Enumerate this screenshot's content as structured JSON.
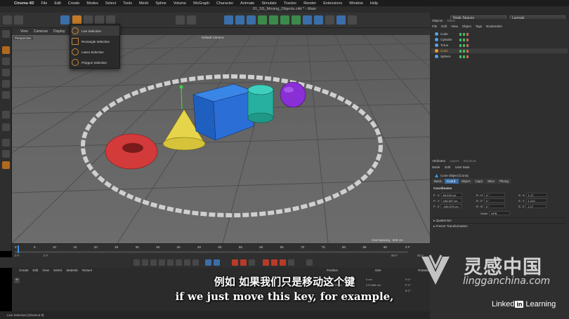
{
  "mac_menu": {
    "apple": "",
    "app": "Cinema 4D",
    "items": [
      "File",
      "Edit",
      "Create",
      "Modes",
      "Select",
      "Tools",
      "Mesh",
      "Spline",
      "Volume",
      "MoGraph",
      "Character",
      "Animate",
      "Simulate",
      "Tracker",
      "Render",
      "Extensions",
      "Window",
      "Help"
    ]
  },
  "window": {
    "title": "01_SS_Moving_Objects.c4d * - Main"
  },
  "layout": {
    "node_spaces": "Node Spaces",
    "layouts": "Layouts"
  },
  "viewport": {
    "menu": [
      "View",
      "Cameras",
      "Display"
    ],
    "label": "Perspective",
    "camera": "Default Camera",
    "grid_spacing": "Grid Spacing : 500 cm"
  },
  "selection_menu": {
    "items": [
      "Live Selection",
      "Rectangle Selection",
      "Lasso Selection",
      "Polygon Selection"
    ]
  },
  "timeline": {
    "ticks": [
      "0",
      "5",
      "10",
      "15",
      "20",
      "25",
      "30",
      "35",
      "40",
      "45",
      "50",
      "55",
      "60",
      "65",
      "70",
      "75",
      "80",
      "85",
      "90"
    ],
    "end_frame": "0 F",
    "field_left": "0 F",
    "field_left2": "0 F",
    "field_right": "90 F",
    "field_right2": "90 F"
  },
  "material": {
    "menu": [
      "Create",
      "Edit",
      "View",
      "Select",
      "Material",
      "Texture"
    ]
  },
  "coord_manager": {
    "headers": [
      "Position",
      "Size",
      "Rotation"
    ],
    "rows": [
      {
        "pos": "0 cm",
        "size": "0 cm",
        "rot": "H 0 °"
      },
      {
        "pos": "-344.579 cm",
        "size": "279.066 cm",
        "rot": "P 0 °"
      },
      {
        "pos": "",
        "size": "",
        "rot": "B 0 °"
      }
    ]
  },
  "status": {
    "text": "Live Selection [Shortcut 9]"
  },
  "object_manager": {
    "tabs": [
      "Objects",
      "Takes"
    ],
    "menu": [
      "File",
      "Edit",
      "View",
      "Object",
      "Tags",
      "Bookmarks"
    ],
    "objects": [
      {
        "name": "Cube",
        "color": "#5aa0e6"
      },
      {
        "name": "Cylinder",
        "color": "#5aa0e6"
      },
      {
        "name": "Torus",
        "color": "#5aa0e6"
      },
      {
        "name": "Cone",
        "color": "#e8a030"
      },
      {
        "name": "Sphere",
        "color": "#5aa0e6"
      }
    ]
  },
  "attributes": {
    "tabs": [
      "Attributes",
      "Layers",
      "Structure"
    ],
    "menu": [
      "Mode",
      "Edit",
      "User Data"
    ],
    "object": "Cone Object [Cone]",
    "subtabs": [
      "Basic",
      "Coord.",
      "Object",
      "Caps",
      "Slice",
      "Phong"
    ],
    "coordinates_label": "Coordinates",
    "pos": [
      {
        "axis": "P . X",
        "value": "66.028 cm"
      },
      {
        "axis": "P . Y",
        "value": "165.487 cm"
      },
      {
        "axis": "P . Z",
        "value": "-344.579 cm"
      }
    ],
    "rot": [
      {
        "axis": "R . H",
        "value": "0 °"
      },
      {
        "axis": "R . P",
        "value": "0 °"
      },
      {
        "axis": "R . B",
        "value": "0 °"
      }
    ],
    "scale": [
      {
        "axis": "S . X",
        "value": "1.17"
      },
      {
        "axis": "S . Y",
        "value": "1.212"
      },
      {
        "axis": "S . Z",
        "value": "1.17"
      }
    ],
    "order_label": "Order",
    "order_value": "HPB",
    "quaternion": "Quaternion",
    "freeze": "Freeze Transformation"
  },
  "subtitle": {
    "zh": "例如 如果我们只是移动这个键",
    "en": "if we just move this key, for example,"
  },
  "watermark": {
    "cn": "灵感中国",
    "url": "lingganchina.com"
  },
  "branding": {
    "linked": "Linked",
    "in": "in",
    "learning": "Learning"
  },
  "colors": {
    "accent": "#3a6ea8",
    "highlight": "#e8a030"
  }
}
